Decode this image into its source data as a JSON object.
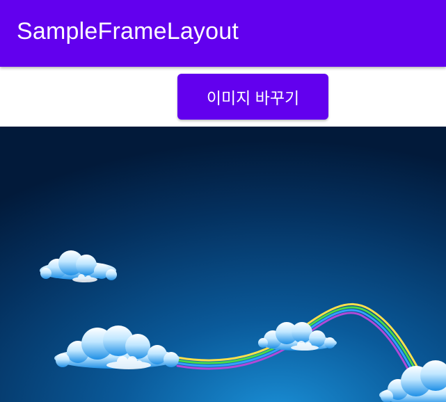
{
  "app_bar": {
    "title": "SampleFrameLayout",
    "color": "#6200EE"
  },
  "toolbar": {
    "change_image_label": "이미지 바꾸기"
  },
  "image": {
    "subject": "night sky with clouds and a rainbow"
  }
}
